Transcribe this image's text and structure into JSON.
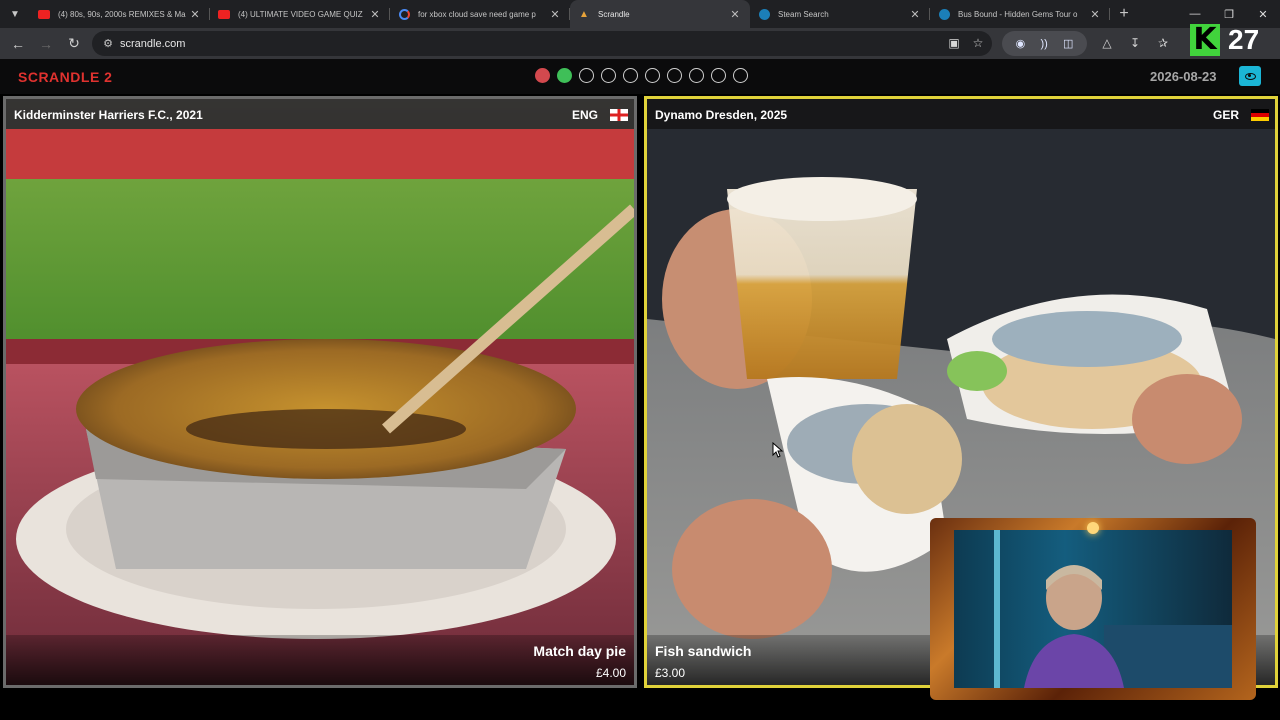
{
  "browser": {
    "tabs": [
      {
        "title": "(4) 80s, 90s, 2000s REMIXES & Ma",
        "icon": "youtube-icon"
      },
      {
        "title": "(4) ULTIMATE VIDEO GAME QUIZ",
        "icon": "youtube-icon"
      },
      {
        "title": "for xbox cloud save need game p",
        "icon": "google-icon"
      },
      {
        "title": "Scrandle",
        "icon": "scrandle-icon",
        "active": true
      },
      {
        "title": "Steam Search",
        "icon": "steam-icon"
      },
      {
        "title": "Bus Bound - Hidden Gems Tour o",
        "icon": "steam-icon"
      }
    ],
    "url": "scrandle.com"
  },
  "overlay": {
    "kick_count": "27"
  },
  "game": {
    "logo": "SCRANDLE 2",
    "progress": [
      "red",
      "green",
      "empty",
      "empty",
      "empty",
      "empty",
      "empty",
      "empty",
      "empty",
      "empty"
    ],
    "date": "2026-08-23",
    "accent_color": "#e0d23a"
  },
  "cards": {
    "left": {
      "club": "Kidderminster Harriers F.C., 2021",
      "country": "ENG",
      "dish": "Match day pie",
      "price": "£4.00"
    },
    "right": {
      "club": "Dynamo Dresden, 2025",
      "country": "GER",
      "dish": "Fish sandwich",
      "price": "£3.00",
      "selected": true
    }
  }
}
